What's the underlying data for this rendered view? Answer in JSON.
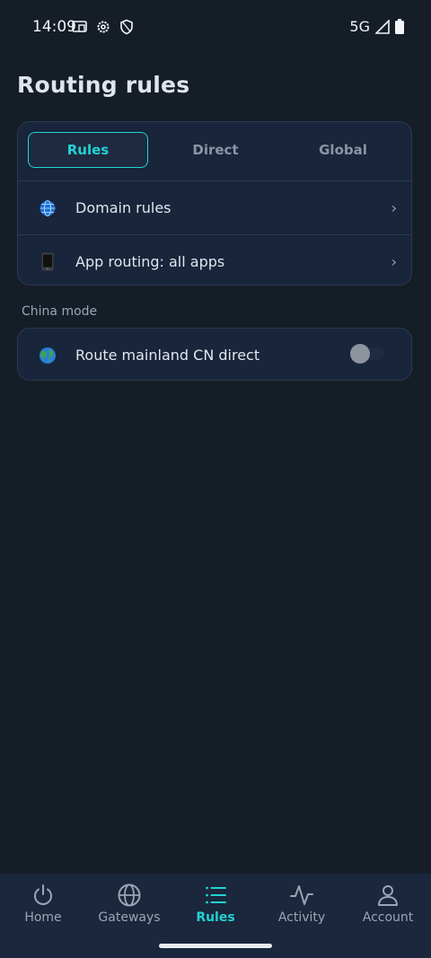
{
  "status_bar": {
    "time": "14:09",
    "network": "5G"
  },
  "page": {
    "title": "Routing rules"
  },
  "tabs": [
    {
      "label": "Rules",
      "active": true
    },
    {
      "label": "Direct",
      "active": false
    },
    {
      "label": "Global",
      "active": false
    }
  ],
  "rules_list": [
    {
      "icon": "globe-icon",
      "label": "Domain rules",
      "chevron": "›"
    },
    {
      "icon": "phone-icon",
      "label": "App routing: all apps",
      "chevron": "›"
    }
  ],
  "china_mode": {
    "section_label": "China mode",
    "icon": "earth-icon",
    "label": "Route mainland CN direct",
    "enabled": false
  },
  "bottom_nav": [
    {
      "icon": "power-icon",
      "label": "Home",
      "active": false
    },
    {
      "icon": "globe-icon",
      "label": "Gateways",
      "active": false
    },
    {
      "icon": "list-icon",
      "label": "Rules",
      "active": true
    },
    {
      "icon": "activity-icon",
      "label": "Activity",
      "active": false
    },
    {
      "icon": "user-icon",
      "label": "Account",
      "active": false
    }
  ],
  "colors": {
    "accent": "#22d3d3",
    "background": "#151d27",
    "card": "#18253b"
  }
}
